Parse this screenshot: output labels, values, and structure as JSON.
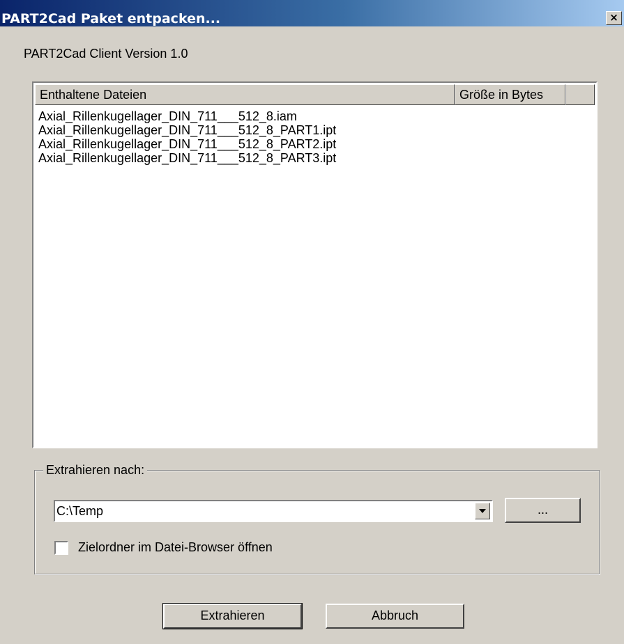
{
  "window": {
    "title": "PART2Cad Paket entpacken...",
    "close_label": "×"
  },
  "version_label": "PART2Cad Client Version 1.0",
  "file_list": {
    "columns": [
      "Enthaltene Dateien",
      "Größe in Bytes",
      ""
    ],
    "rows": [
      "Axial_Rillenkugellager_DIN_711___512_8.iam",
      "Axial_Rillenkugellager_DIN_711___512_8_PART1.ipt",
      "Axial_Rillenkugellager_DIN_711___512_8_PART2.ipt",
      "Axial_Rillenkugellager_DIN_711___512_8_PART3.ipt"
    ]
  },
  "extract_group": {
    "legend": "Extrahieren nach:",
    "path_value": "C:\\Temp",
    "browse_label": "...",
    "open_in_browser_label": "Zielordner im Datei-Browser öffnen",
    "open_in_browser_checked": false
  },
  "buttons": {
    "extract_label": "Extrahieren",
    "cancel_label": "Abbruch"
  },
  "colors": {
    "titlebar_start": "#0a246a",
    "titlebar_end": "#a6caf0",
    "dialog_face": "#d4d0c8"
  }
}
